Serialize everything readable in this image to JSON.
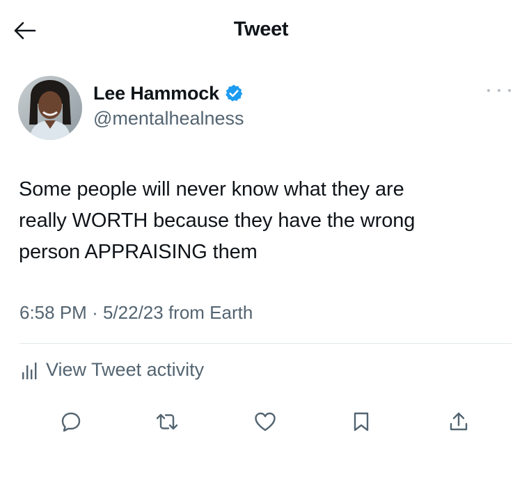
{
  "header": {
    "title": "Tweet",
    "back_icon": "arrow-left-icon"
  },
  "author": {
    "name": "Lee Hammock",
    "handle": "@mentalhealness",
    "verified": true,
    "verified_color": "#1d9bf0"
  },
  "tweet": {
    "text": "Some people will never know what they are\nreally WORTH because they have the wrong\nperson APPRAISING them",
    "time": "6:58 PM",
    "separator": "·",
    "date": "5/22/23",
    "source": "from Earth"
  },
  "activity": {
    "label": "View Tweet activity",
    "icon": "bar-chart-icon"
  },
  "actions": [
    {
      "name": "reply",
      "icon": "reply-icon"
    },
    {
      "name": "retweet",
      "icon": "retweet-icon"
    },
    {
      "name": "like",
      "icon": "heart-icon"
    },
    {
      "name": "bookmark",
      "icon": "bookmark-icon"
    },
    {
      "name": "share",
      "icon": "share-icon"
    }
  ],
  "colors": {
    "text_primary": "#0f1419",
    "text_secondary": "#536471",
    "divider": "#e3e8ec",
    "accent": "#1d9bf0"
  }
}
